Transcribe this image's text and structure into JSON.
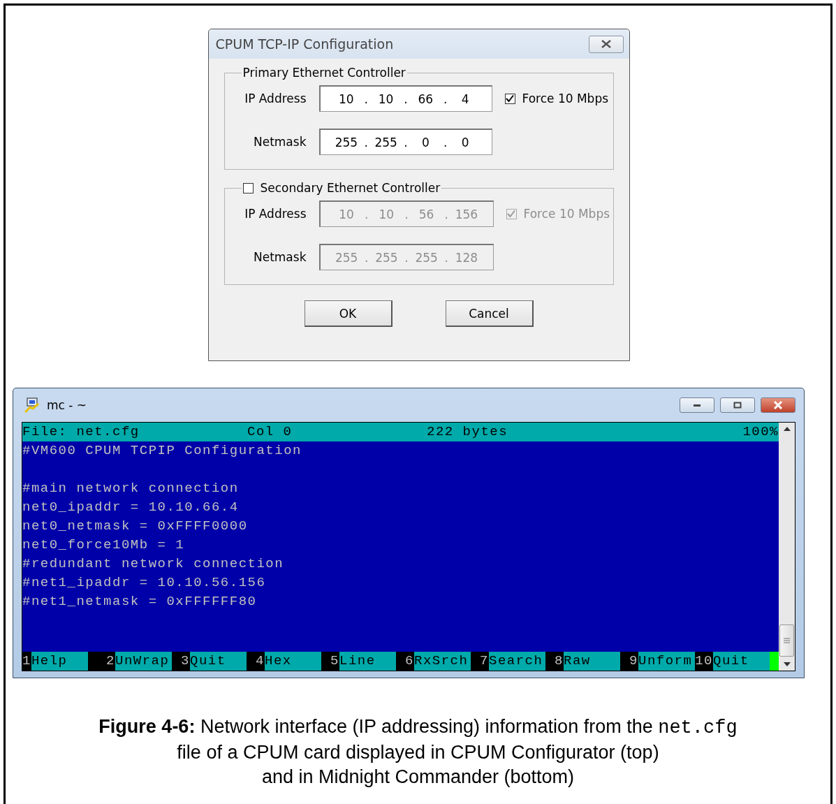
{
  "dialog": {
    "title": "CPUM TCP-IP Configuration",
    "groups": [
      {
        "kind": "plain",
        "title": "Primary Ethernet Controller",
        "enabled": true,
        "fields": [
          {
            "label": "IP Address",
            "octets": [
              "10",
              "10",
              "66",
              "4"
            ]
          },
          {
            "label": "Netmask",
            "octets": [
              "255",
              "255",
              "0",
              "0"
            ]
          }
        ],
        "force": {
          "label": "Force 10 Mbps",
          "checked": true
        }
      },
      {
        "kind": "checkbox",
        "title": "Secondary Ethernet Controller",
        "enabled": false,
        "fields": [
          {
            "label": "IP Address",
            "octets": [
              "10",
              "10",
              "56",
              "156"
            ]
          },
          {
            "label": "Netmask",
            "octets": [
              "255",
              "255",
              "255",
              "128"
            ]
          }
        ],
        "force": {
          "label": "Force 10 Mbps",
          "checked": true
        }
      }
    ],
    "separator": ".",
    "buttons": [
      "OK",
      "Cancel"
    ]
  },
  "terminal": {
    "title": "mc - ~",
    "status_bar": {
      "file": "File: net.cfg",
      "column": "Col 0",
      "size": "222 bytes",
      "percent": "100%"
    },
    "text_blocks": [
      [
        "#VM600 CPUM TCPIP Configuration"
      ],
      [
        "#main network connection",
        "net0_ipaddr = 10.10.66.4",
        "net0_netmask = 0xFFFF0000",
        "net0_force10Mb = 1",
        "#redundant network connection",
        "#net1_ipaddr = 10.10.56.156",
        "#net1_netmask = 0xFFFFFF80"
      ]
    ],
    "function_keys": [
      {
        "number": "1",
        "label": "Help"
      },
      {
        "number": "2",
        "label": "UnWrap"
      },
      {
        "number": "3",
        "label": "Quit"
      },
      {
        "number": "4",
        "label": "Hex"
      },
      {
        "number": "5",
        "label": "Line"
      },
      {
        "number": "6",
        "label": "RxSrch"
      },
      {
        "number": "7",
        "label": "Search"
      },
      {
        "number": "8",
        "label": "Raw"
      },
      {
        "number": "9",
        "label": "Unform"
      },
      {
        "number": "10",
        "label": "Quit"
      }
    ]
  },
  "caption": {
    "lead": "Figure 4-6:",
    "text": "Network interface (IP addressing) information from the",
    "code": "net.cfg",
    "rest_lines": [
      "file of a CPUM card displayed in CPUM Configurator (top)",
      "and in Midnight Commander (bottom)"
    ]
  }
}
